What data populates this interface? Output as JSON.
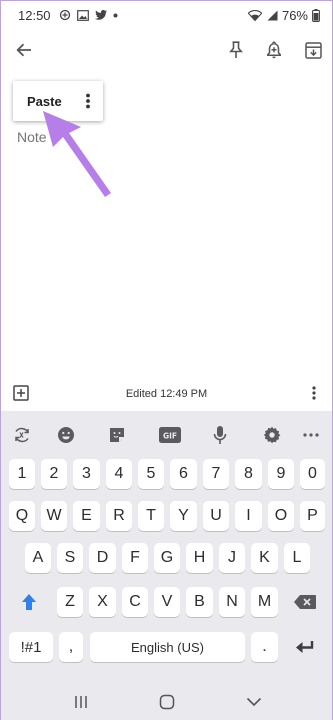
{
  "status_bar": {
    "time": "12:50",
    "battery": "76%",
    "icons": [
      "data-saver-icon",
      "image-icon",
      "twitter-icon",
      "dot-icon",
      "wifi-icon",
      "signal-icon",
      "battery-icon"
    ]
  },
  "app_bar": {
    "back_icon": "arrow-left-icon",
    "actions": [
      "pin-icon",
      "add-reminder-icon",
      "archive-icon"
    ]
  },
  "popup": {
    "paste_label": "Paste"
  },
  "note": {
    "placeholder": "Note"
  },
  "editor_bar": {
    "edited_text": "Edited 12:49 PM"
  },
  "keyboard": {
    "toolbar": [
      "sync-icon",
      "emoji-icon",
      "sticker-icon",
      "gif-icon",
      "mic-icon",
      "settings-icon",
      "more-icon"
    ],
    "gif_label": "GIF",
    "rows": [
      [
        "1",
        "2",
        "3",
        "4",
        "5",
        "6",
        "7",
        "8",
        "9",
        "0"
      ],
      [
        "Q",
        "W",
        "E",
        "R",
        "T",
        "Y",
        "U",
        "I",
        "O",
        "P"
      ],
      [
        "A",
        "S",
        "D",
        "F",
        "G",
        "H",
        "J",
        "K",
        "L"
      ],
      [
        "Z",
        "X",
        "C",
        "V",
        "B",
        "N",
        "M"
      ]
    ],
    "symbols_label": "!#1",
    "comma_label": ",",
    "space_label": "English (US)",
    "period_label": ".",
    "accent_color": "#2f80ed"
  },
  "nav_bar": {
    "buttons": [
      "recents-icon",
      "home-icon",
      "back-chevron-icon"
    ]
  },
  "annotation": {
    "arrow_color": "#b57ee8"
  }
}
